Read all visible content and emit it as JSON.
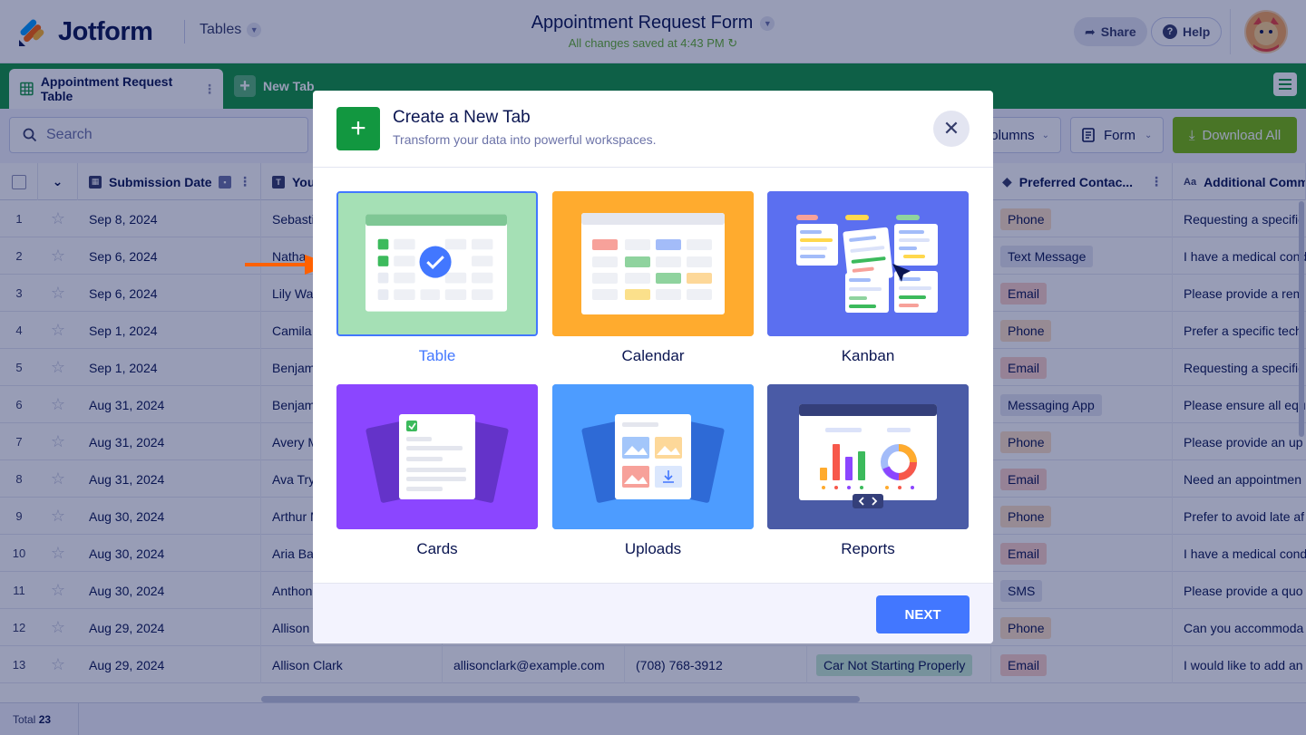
{
  "header": {
    "logo_text": "Jotform",
    "tables_label": "Tables",
    "form_title": "Appointment Request Form",
    "saved_status": "All changes saved at 4:43 PM",
    "share_label": "Share",
    "help_label": "Help"
  },
  "tabs": {
    "active_tab": "Appointment Request Table",
    "new_tab_label": "New Tab"
  },
  "toolbar": {
    "search_placeholder": "Search",
    "columns_label": "olumns",
    "form_label": "Form",
    "download_label": "Download All"
  },
  "table": {
    "headers": {
      "submission_date": "Submission Date",
      "name_col": "You",
      "preferred_contact": "Preferred Contac...",
      "additional_comments": "Additional Comm"
    },
    "rows": [
      {
        "num": "1",
        "date": "Sep 8, 2024",
        "name": "Sebasti",
        "contact": "Phone",
        "contact_type": "phone",
        "comment": "Requesting a specific"
      },
      {
        "num": "2",
        "date": "Sep 6, 2024",
        "name": "Natha",
        "contact": "Text Message",
        "contact_type": "text",
        "comment": "I have a medical cond"
      },
      {
        "num": "3",
        "date": "Sep 6, 2024",
        "name": "Lily Wa",
        "contact": "Email",
        "contact_type": "email",
        "comment": "Please provide a rem"
      },
      {
        "num": "4",
        "date": "Sep 1, 2024",
        "name": "Camila",
        "contact": "Phone",
        "contact_type": "phone",
        "comment": "Prefer a specific tech"
      },
      {
        "num": "5",
        "date": "Sep 1, 2024",
        "name": "Benjam",
        "contact": "Email",
        "contact_type": "email",
        "comment": "Requesting a specific"
      },
      {
        "num": "6",
        "date": "Aug 31, 2024",
        "name": "Benjam",
        "contact": "Messaging App",
        "contact_type": "msg",
        "comment": "Please ensure all equ"
      },
      {
        "num": "7",
        "date": "Aug 31, 2024",
        "name": "Avery M",
        "contact": "Phone",
        "contact_type": "phone",
        "comment": "Please provide an up"
      },
      {
        "num": "8",
        "date": "Aug 31, 2024",
        "name": "Ava Try",
        "contact": "Email",
        "contact_type": "email",
        "comment": "Need an appointmen"
      },
      {
        "num": "9",
        "date": "Aug 30, 2024",
        "name": "Arthur M",
        "contact": "Phone",
        "contact_type": "phone",
        "comment": "Prefer to avoid late af"
      },
      {
        "num": "10",
        "date": "Aug 30, 2024",
        "name": "Aria Bal",
        "contact": "Email",
        "contact_type": "email",
        "comment": "I have a medical cond"
      },
      {
        "num": "11",
        "date": "Aug 30, 2024",
        "name": "Anthon",
        "contact": "SMS",
        "contact_type": "sms",
        "comment": "Please provide a quo"
      },
      {
        "num": "12",
        "date": "Aug 29, 2024",
        "name": "Allison",
        "contact": "Phone",
        "contact_type": "phone",
        "comment": "Can you accommoda"
      },
      {
        "num": "13",
        "date": "Aug 29, 2024",
        "name": "Allison Clark",
        "email": "allisonclark@example.com",
        "phone": "(708) 768-3912",
        "issue": "Car Not Starting Properly",
        "contact": "Email",
        "contact_type": "email",
        "comment": "I would like to add an"
      }
    ],
    "total_label": "Total",
    "total_count": "23"
  },
  "modal": {
    "title": "Create a New Tab",
    "subtitle": "Transform your data into powerful workspaces.",
    "options": [
      {
        "label": "Table",
        "selected": true
      },
      {
        "label": "Calendar",
        "selected": false
      },
      {
        "label": "Kanban",
        "selected": false
      },
      {
        "label": "Cards",
        "selected": false
      },
      {
        "label": "Uploads",
        "selected": false
      },
      {
        "label": "Reports",
        "selected": false
      }
    ],
    "next_label": "NEXT"
  },
  "colors": {
    "brand_green": "#129740",
    "accent_blue": "#4277ff",
    "table_card_bg": "#a5e0b5",
    "calendar_card_bg": "#ffab2e",
    "kanban_card_bg": "#5b6ff0",
    "cards_card_bg": "#8b46ff",
    "uploads_card_bg": "#4d9cff",
    "reports_card_bg": "#4a5ba6",
    "arrow": "#ff6100"
  },
  "icons": [
    "jotform-logo",
    "chevron-down-icon",
    "share-icon",
    "help-icon",
    "avatar",
    "grid-table-icon",
    "plus-icon",
    "hamburger-menu-icon",
    "search-icon",
    "form-icon",
    "download-icon",
    "calendar-icon",
    "text-type-icon",
    "tag-icon",
    "star-icon",
    "close-icon",
    "pointer-arrow"
  ]
}
